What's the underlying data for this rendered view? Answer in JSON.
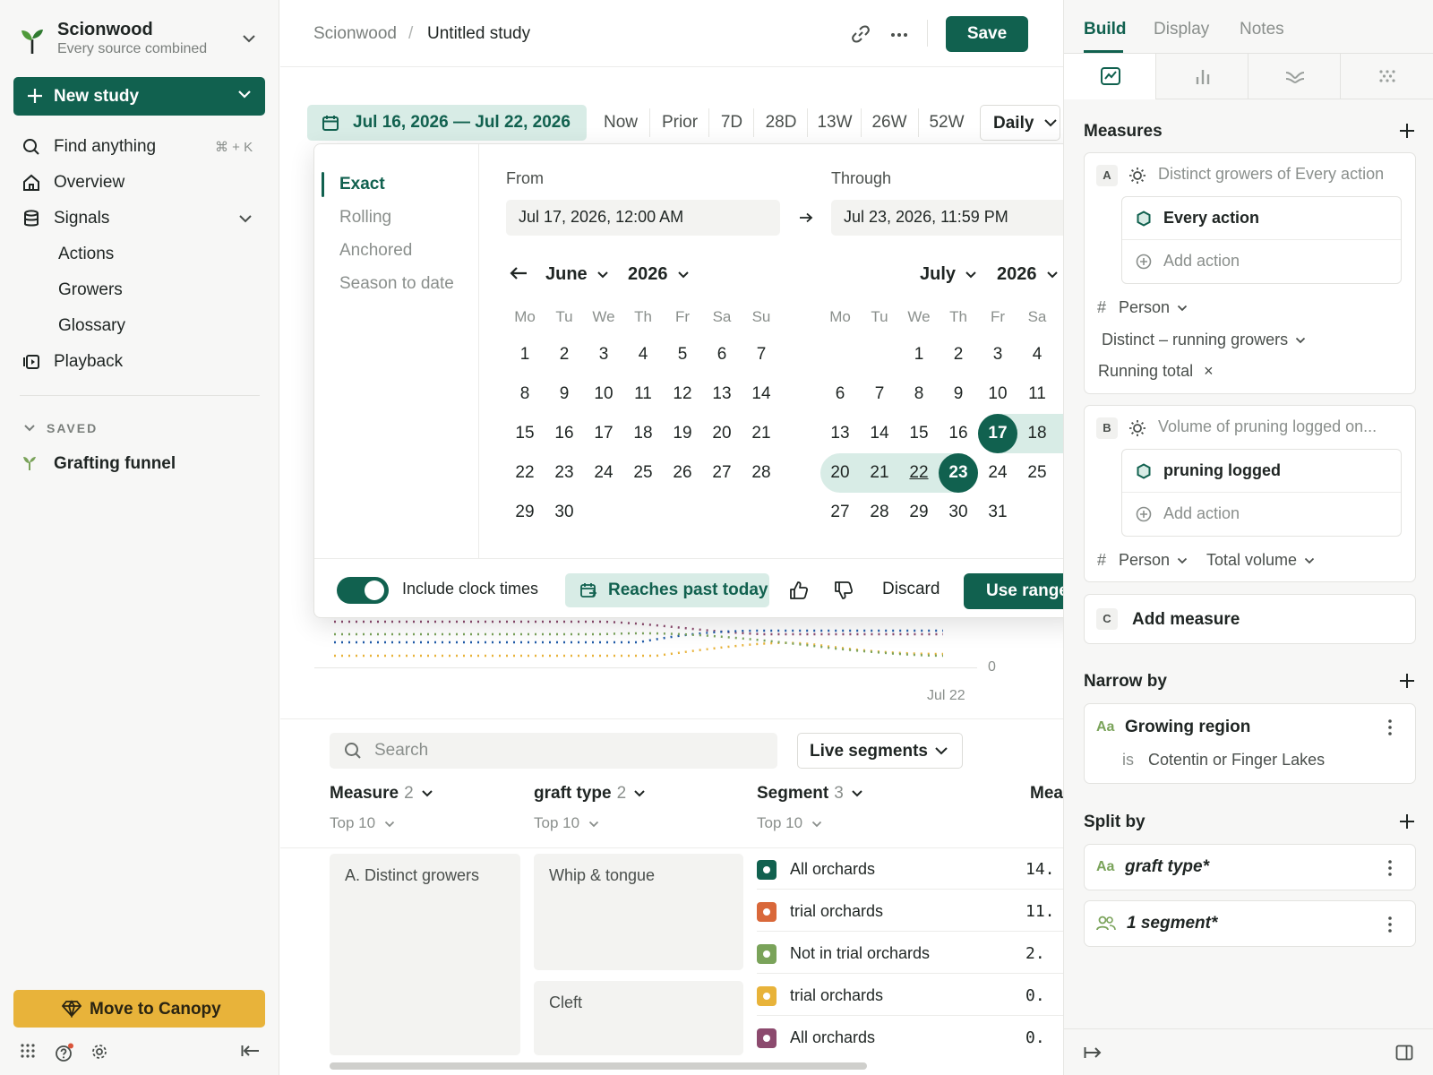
{
  "sidebar": {
    "workspace_name": "Scionwood",
    "workspace_sub": "Every source combined",
    "new_study_label": "New study",
    "nav": {
      "find": "Find anything",
      "find_kbd": "⌘ + K",
      "overview": "Overview",
      "signals": "Signals",
      "actions": "Actions",
      "growers": "Growers",
      "glossary": "Glossary",
      "playback": "Playback"
    },
    "saved_heading": "SAVED",
    "saved_item": "Grafting funnel",
    "canopy_label": "Move to Canopy"
  },
  "header": {
    "crumb_workspace": "Scionwood",
    "crumb_sep": "/",
    "crumb_study": "Untitled study",
    "save_label": "Save"
  },
  "toolbar": {
    "date_range": "Jul 16, 2026 — Jul 22, 2026",
    "presets": [
      "Now",
      "Prior",
      "7D",
      "28D",
      "13W",
      "26W",
      "52W"
    ],
    "granularity": "Daily"
  },
  "chart": {
    "y_zero": "0",
    "x_last": "Jul 22"
  },
  "picker": {
    "modes": [
      "Exact",
      "Rolling",
      "Anchored",
      "Season to date"
    ],
    "from_label": "From",
    "through_label": "Through",
    "from_value": "Jul 17, 2026, 12:00 AM",
    "through_value": "Jul 23, 2026, 11:59 PM",
    "weekdays_left": [
      "Mo",
      "Tu",
      "We",
      "Th",
      "Fr",
      "Sa",
      "Su"
    ],
    "weekdays_right": [
      "Mo",
      "Tu",
      "We",
      "Th",
      "Fr",
      "Sa"
    ],
    "left_month": "June",
    "left_year": "2026",
    "right_month": "July",
    "right_year": "2026",
    "include_clock": "Include clock times",
    "reaches_past": "Reaches past today",
    "discard": "Discard",
    "use_range": "Use range"
  },
  "table": {
    "search_placeholder": "Search",
    "live_segments": "Live segments",
    "col_measure": "Measure",
    "col_measure_count": "2",
    "col_graft": "graft type",
    "col_graft_count": "2",
    "col_segment": "Segment",
    "col_segment_count": "3",
    "col_mea": "Mea",
    "top_label": "Top 10",
    "measure_cell": "A. Distinct growers",
    "graft_cells": [
      "Whip & tongue",
      "Cleft"
    ],
    "segments": [
      {
        "label": "All orchards",
        "value": "14.",
        "color": "#11614f"
      },
      {
        "label": "trial orchards",
        "value": "11.",
        "color": "#d9683a"
      },
      {
        "label": "Not in trial orchards",
        "value": "2.",
        "color": "#7aa35a"
      },
      {
        "label": "trial orchards",
        "value": "0.",
        "color": "#e8b33a"
      },
      {
        "label": "All orchards",
        "value": "0.",
        "color": "#8c4a6e"
      }
    ]
  },
  "right": {
    "tabs": [
      "Build",
      "Display",
      "Notes"
    ],
    "measures_heading": "Measures",
    "measure_a": {
      "badge": "A",
      "title": "Distinct growers of Every action",
      "action": "Every action",
      "add_action": "Add action",
      "hash": "#",
      "person": "Person",
      "distinct": "Distinct – running growers",
      "running": "Running total",
      "remove": "×"
    },
    "measure_b": {
      "badge": "B",
      "title": "Volume of pruning logged on...",
      "action": "pruning logged",
      "add_action": "Add action",
      "hash": "#",
      "person": "Person",
      "total": "Total volume"
    },
    "add_measure": {
      "badge": "C",
      "label": "Add measure"
    },
    "narrow_heading": "Narrow by",
    "narrow": {
      "icon_text": "Aa",
      "label": "Growing region",
      "op": "is",
      "value": "Cotentin or Finger Lakes"
    },
    "split_heading": "Split by",
    "split": [
      {
        "icon_text": "Aa",
        "label": "graft type*"
      },
      {
        "label": "1 segment*"
      }
    ]
  }
}
